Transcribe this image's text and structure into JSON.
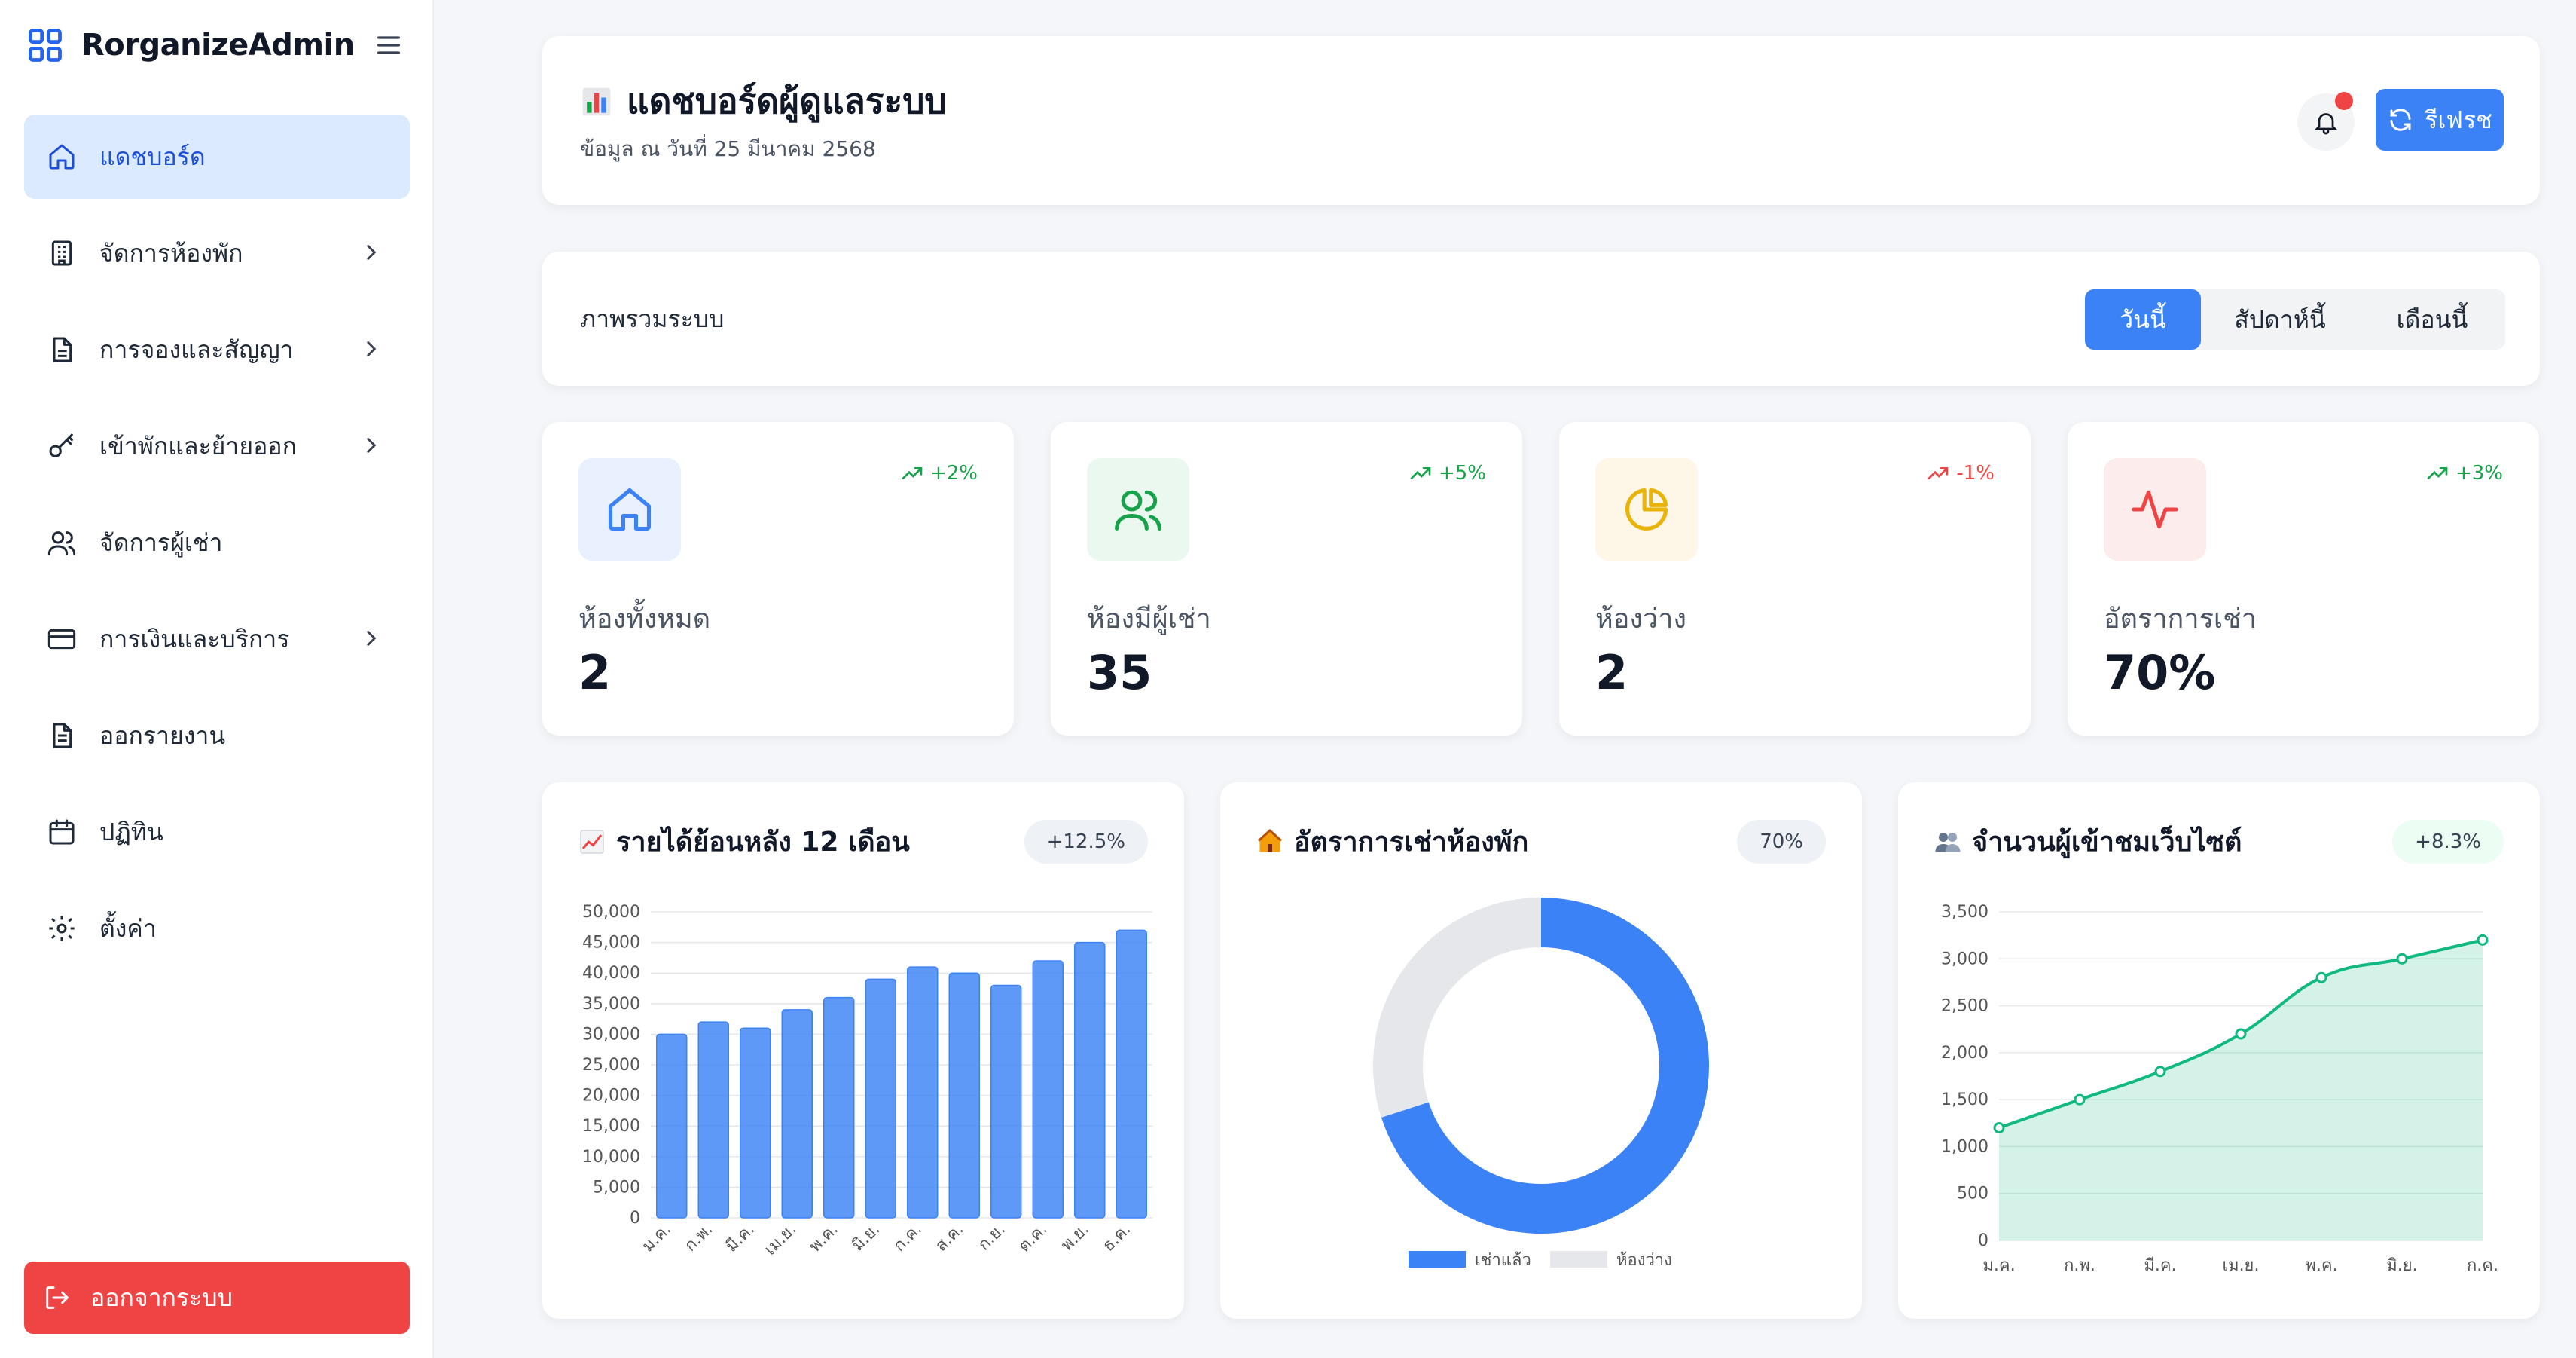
{
  "app": {
    "name": "RorganizeAdmin"
  },
  "sidebar": {
    "items": [
      {
        "label": "แดชบอร์ด",
        "icon": "home-icon",
        "active": true,
        "chevron": false
      },
      {
        "label": "จัดการห้องพัก",
        "icon": "building-icon",
        "active": false,
        "chevron": true
      },
      {
        "label": "การจองและสัญญา",
        "icon": "document-icon",
        "active": false,
        "chevron": true
      },
      {
        "label": "เข้าพักและย้ายออก",
        "icon": "key-icon",
        "active": false,
        "chevron": true
      },
      {
        "label": "จัดการผู้เช่า",
        "icon": "users-icon",
        "active": false,
        "chevron": false
      },
      {
        "label": "การเงินและบริการ",
        "icon": "credit-card-icon",
        "active": false,
        "chevron": true
      },
      {
        "label": "ออกรายงาน",
        "icon": "report-icon",
        "active": false,
        "chevron": false
      },
      {
        "label": "ปฏิทิน",
        "icon": "calendar-icon",
        "active": false,
        "chevron": false
      },
      {
        "label": "ตั้งค่า",
        "icon": "gear-icon",
        "active": false,
        "chevron": false
      }
    ],
    "logout_label": "ออกจากระบบ"
  },
  "header": {
    "title": "แดชบอร์ดผู้ดูแลระบบ",
    "subtitle": "ข้อมูล ณ วันที่ 25 มีนาคม 2568",
    "refresh_label": "รีเฟรช"
  },
  "overview": {
    "label": "ภาพรวมระบบ",
    "periods": [
      "วันนี้",
      "สัปดาห์นี้",
      "เดือนนี้"
    ],
    "selected_period": "วันนี้"
  },
  "stats": [
    {
      "label": "ห้องทั้งหมด",
      "value": "2",
      "trend": "+2%",
      "direction": "up",
      "icon": "home-icon",
      "color": "#3b82f6",
      "bg": "#eaf1fe"
    },
    {
      "label": "ห้องมีผู้เช่า",
      "value": "35",
      "trend": "+5%",
      "direction": "up",
      "icon": "users-icon",
      "color": "#16a34a",
      "bg": "#eaf8ef"
    },
    {
      "label": "ห้องว่าง",
      "value": "2",
      "trend": "-1%",
      "direction": "down",
      "icon": "pie-chart-icon",
      "color": "#eab308",
      "bg": "#fef6e6"
    },
    {
      "label": "อัตราการเช่า",
      "value": "70%",
      "trend": "+3%",
      "direction": "up",
      "icon": "activity-icon",
      "color": "#ef4444",
      "bg": "#fdecec"
    }
  ],
  "colors": {
    "primary": "#3b82f6",
    "success": "#16a34a",
    "danger": "#ef4444",
    "warning": "#eab308",
    "line": "#10b981"
  },
  "charts": {
    "revenue": {
      "title": "รายได้ย้อนหลัง 12 เดือน",
      "badge": "+12.5%"
    },
    "occupancy": {
      "title": "อัตราการเช่าห้องพัก",
      "badge": "70%"
    },
    "visitors": {
      "title": "จำนวนผู้เข้าชมเว็บไซต์",
      "badge": "+8.3%"
    }
  },
  "chart_data": [
    {
      "type": "bar",
      "title": "รายได้ย้อนหลัง 12 เดือน",
      "categories": [
        "ม.ค.",
        "ก.พ.",
        "มี.ค.",
        "เม.ย.",
        "พ.ค.",
        "มิ.ย.",
        "ก.ค.",
        "ส.ค.",
        "ก.ย.",
        "ต.ค.",
        "พ.ย.",
        "ธ.ค."
      ],
      "values": [
        30000,
        32000,
        31000,
        34000,
        36000,
        39000,
        41000,
        40000,
        38000,
        42000,
        45000,
        47000
      ],
      "ylim": [
        0,
        50000
      ],
      "yticks": [
        "0",
        "5,000",
        "10,000",
        "15,000",
        "20,000",
        "25,000",
        "30,000",
        "35,000",
        "40,000",
        "45,000",
        "50,000"
      ],
      "color": "#3b82f6",
      "grid": true
    },
    {
      "type": "pie",
      "title": "อัตราการเช่าห้องพัก",
      "labels": [
        "เช่าแล้ว",
        "ห้องว่าง"
      ],
      "values": [
        70,
        30
      ],
      "colors": [
        "#3b82f6",
        "#e5e7eb"
      ],
      "legend": "bottom"
    },
    {
      "type": "area",
      "title": "จำนวนผู้เข้าชมเว็บไซต์",
      "categories": [
        "ม.ค.",
        "ก.พ.",
        "มี.ค.",
        "เม.ย.",
        "พ.ค.",
        "มิ.ย.",
        "ก.ค."
      ],
      "values": [
        1200,
        1500,
        1800,
        2200,
        2800,
        3000,
        3200
      ],
      "ylim": [
        0,
        3500
      ],
      "yticks": [
        "0",
        "500",
        "1,000",
        "1,500",
        "2,000",
        "2,500",
        "3,000",
        "3,500"
      ],
      "color": "#10b981",
      "grid": true
    }
  ]
}
